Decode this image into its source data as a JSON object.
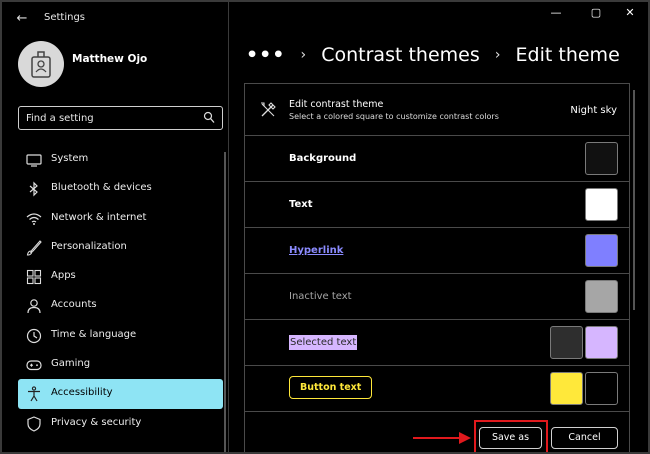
{
  "window": {
    "title": "Settings",
    "back_glyph": "←",
    "min_glyph": "—",
    "max_glyph": "▢",
    "close_glyph": "✕"
  },
  "user": {
    "name": "Matthew Ojo"
  },
  "search": {
    "placeholder": "Find a setting"
  },
  "sidebar": {
    "items": [
      {
        "label": "System",
        "icon": "monitor-icon"
      },
      {
        "label": "Bluetooth & devices",
        "icon": "bluetooth-icon"
      },
      {
        "label": "Network & internet",
        "icon": "wifi-icon"
      },
      {
        "label": "Personalization",
        "icon": "brush-icon"
      },
      {
        "label": "Apps",
        "icon": "apps-icon"
      },
      {
        "label": "Accounts",
        "icon": "person-icon"
      },
      {
        "label": "Time & language",
        "icon": "clock-icon"
      },
      {
        "label": "Gaming",
        "icon": "gamepad-icon"
      },
      {
        "label": "Accessibility",
        "icon": "accessibility-icon",
        "active": true
      },
      {
        "label": "Privacy & security",
        "icon": "shield-icon"
      }
    ]
  },
  "breadcrumb": {
    "dots": "•••",
    "sep": "›",
    "crumb1": "Contrast themes",
    "crumb2": "Edit theme"
  },
  "panel": {
    "title": "Edit contrast theme",
    "subtitle": "Select a colored square to customize contrast colors",
    "theme_name": "Night sky"
  },
  "colors": {
    "background": "#000000",
    "text": "#ffffff",
    "hyperlink": "#7f7fff",
    "inactive_text": "#a6a6a6",
    "selected_text_fg": "#2e2e2e",
    "selected_text_bg": "#d6b6ff",
    "button_text_fg": "#ffe83a",
    "button_text_bg": "#000000",
    "accent": "#8ee4f4",
    "highlight": "#e0191d"
  },
  "rows": {
    "background": "Background",
    "text": "Text",
    "hyperlink": "Hyperlink",
    "inactive": "Inactive text",
    "selected": "Selected text",
    "button": "Button text"
  },
  "footer": {
    "save_label": "Save as",
    "cancel_label": "Cancel"
  }
}
